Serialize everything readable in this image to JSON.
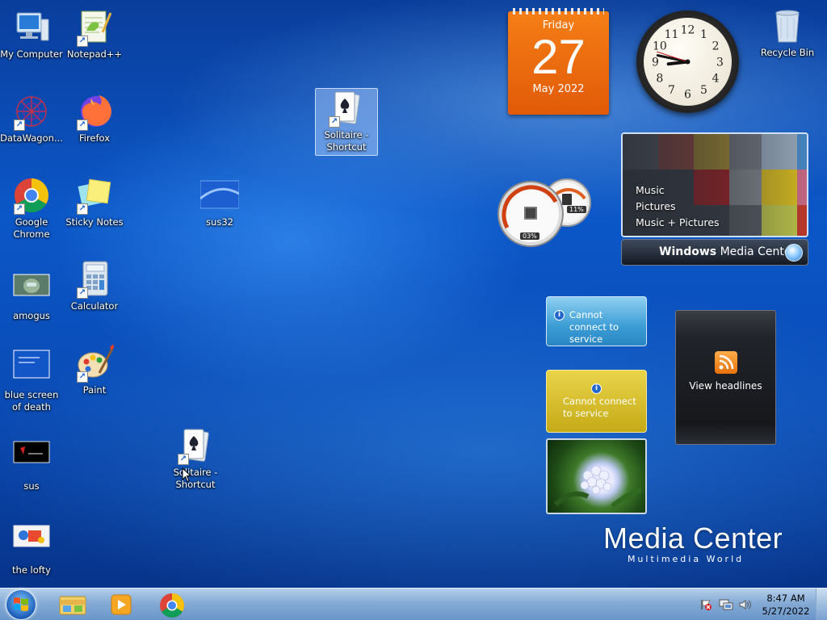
{
  "desktop_icons": [
    {
      "label": "My Computer",
      "icon": "computer-icon",
      "shortcut": false
    },
    {
      "label": "Notepad++",
      "icon": "notepadpp-icon",
      "shortcut": true
    },
    {
      "label": "DataWagon...",
      "icon": "datawagon-icon",
      "shortcut": true
    },
    {
      "label": "Firefox",
      "icon": "firefox-icon",
      "shortcut": true
    },
    {
      "label": "Google Chrome",
      "icon": "chrome-icon",
      "shortcut": true
    },
    {
      "label": "Sticky Notes",
      "icon": "sticky-notes-icon",
      "shortcut": true
    },
    {
      "label": "sus32",
      "icon": "image-file-icon",
      "shortcut": false
    },
    {
      "label": "amogus",
      "icon": "image-file-icon",
      "shortcut": false
    },
    {
      "label": "Calculator",
      "icon": "calculator-icon",
      "shortcut": true
    },
    {
      "label": "blue screen of death",
      "icon": "image-file-icon",
      "shortcut": false
    },
    {
      "label": "Paint",
      "icon": "paint-icon",
      "shortcut": true
    },
    {
      "label": "sus",
      "icon": "image-file-icon",
      "shortcut": false
    },
    {
      "label": "Solitaire - Shortcut",
      "icon": "solitaire-icon",
      "shortcut": true
    },
    {
      "label": "the lofty",
      "icon": "image-file-icon",
      "shortcut": false
    },
    {
      "label": "Solitaire - Shortcut",
      "icon": "solitaire-icon",
      "shortcut": true,
      "selected": true
    },
    {
      "label": "Recycle Bin",
      "icon": "recycle-bin-icon",
      "shortcut": false
    }
  ],
  "calendar": {
    "day_of_week": "Friday",
    "day": "27",
    "month_year": "May 2022"
  },
  "clock": {
    "numbers": [
      "12",
      "1",
      "2",
      "3",
      "4",
      "5",
      "6",
      "7",
      "8",
      "9",
      "10",
      "11"
    ],
    "time": "8:47"
  },
  "cpu_meter": {
    "cpu": "03%",
    "memory": "11%"
  },
  "media_center": {
    "menu": [
      "Music",
      "Pictures",
      "Music + Pictures"
    ],
    "bar_bold": "Windows",
    "bar_rest": " Media Center"
  },
  "weather": {
    "message": "Cannot connect to service"
  },
  "currency": {
    "message": "Cannot connect to service"
  },
  "feed": {
    "label": "View headlines"
  },
  "branding": {
    "title": "Media Center",
    "subtitle": "Multimedia World"
  },
  "taskbar": {
    "pinned": [
      "windows-explorer-icon",
      "media-player-icon",
      "chrome-icon"
    ],
    "time": "8:47 AM",
    "date": "5/27/2022"
  },
  "colors": {
    "calendar": "#e8650b",
    "wallpaper": "#0b57c8"
  }
}
